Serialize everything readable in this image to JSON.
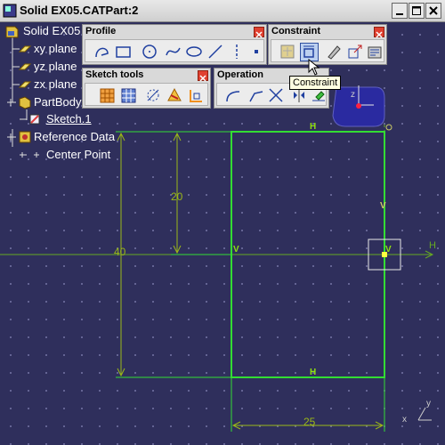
{
  "window": {
    "title": "Solid EX05.CATPart:2",
    "minimize_label": "minimize",
    "maximize_label": "maximize",
    "close_label": "close"
  },
  "tree": [
    {
      "label": "Solid EX05",
      "icon": "part-icon"
    },
    {
      "label": "xy plane",
      "icon": "plane-icon"
    },
    {
      "label": "yz plane",
      "icon": "plane-icon"
    },
    {
      "label": "zx plane",
      "icon": "plane-icon"
    },
    {
      "label": "PartBody",
      "icon": "body-icon"
    },
    {
      "label": "Sketch.1",
      "icon": "sketch-icon"
    },
    {
      "label": "Reference Data",
      "icon": "reference-icon"
    },
    {
      "label": "Center Point",
      "icon": "point-icon"
    }
  ],
  "toolbars": {
    "profile": {
      "title": "Profile",
      "tools": [
        "profile-tool-icon",
        "rectangle-tool-icon",
        "circle-tool-icon",
        "spline-tool-icon",
        "ellipse-tool-icon",
        "line-tool-icon",
        "axis-tool-icon",
        "point-tool-icon"
      ]
    },
    "constraint": {
      "title": "Constraint",
      "tools": [
        "constraints-dialog-icon",
        "constraint-icon",
        "auto-constraint-icon",
        "animate-constraint-icon",
        "edit-multi-constraint-icon"
      ]
    },
    "sketch_tools": {
      "title": "Sketch tools",
      "tools": [
        "grid-icon",
        "snap-to-point-icon",
        "construction-element-icon",
        "geometrical-constraints-icon",
        "dimensional-constraints-icon"
      ]
    },
    "operation": {
      "title": "Operation",
      "tools": [
        "corner-icon",
        "chamfer-icon",
        "trim-icon",
        "mirror-icon",
        "project-3d-elements-icon"
      ]
    }
  },
  "tooltip": "Constraint",
  "sketch": {
    "dimensions": {
      "height_total": "40",
      "height_partial": "20",
      "width": "25"
    },
    "constraint_marks": {
      "top": "H",
      "bottom": "H",
      "left": "V",
      "right": "V",
      "right_mid": "V"
    },
    "axis_h_label": "H",
    "compass_label": "z",
    "triad_x": "x",
    "triad_y": "y"
  },
  "colors": {
    "background": "#2f2f5c",
    "geometry": "#33dd33",
    "dimension": "#9bb817",
    "axis": "#66aa22",
    "tooltip_bg": "#ffffe1"
  }
}
